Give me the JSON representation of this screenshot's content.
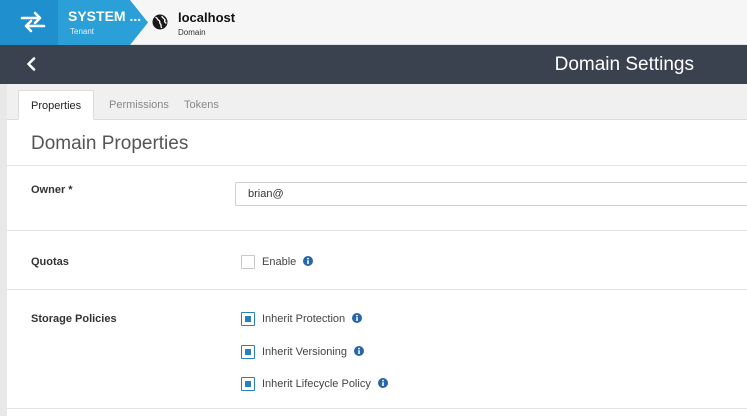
{
  "breadcrumb": {
    "tenant": {
      "name": "SYSTEM ...",
      "label": "Tenant"
    },
    "domain": {
      "name": "localhost",
      "label": "Domain"
    }
  },
  "header": {
    "title": "Domain Settings"
  },
  "tabs": [
    {
      "label": "Properties",
      "active": true
    },
    {
      "label": "Permissions",
      "active": false
    },
    {
      "label": "Tokens",
      "active": false
    }
  ],
  "section": {
    "title": "Domain Properties"
  },
  "owner": {
    "label": "Owner *",
    "value": "brian@"
  },
  "quotas": {
    "label": "Quotas",
    "enable_label": "Enable",
    "checked": false
  },
  "storage": {
    "label": "Storage Policies",
    "options": [
      {
        "label": "Inherit Protection",
        "checked": true
      },
      {
        "label": "Inherit Versioning",
        "checked": true
      },
      {
        "label": "Inherit Lifecycle Policy",
        "checked": true
      }
    ]
  },
  "colors": {
    "accent": "#2a9fd8",
    "header_bg": "#3a4250",
    "checkbox": "#2a7fbd"
  },
  "icons": {
    "tenant": "switch-arrows-icon",
    "domain": "globe-icon",
    "back": "chevron-left-icon",
    "info": "info-icon"
  }
}
